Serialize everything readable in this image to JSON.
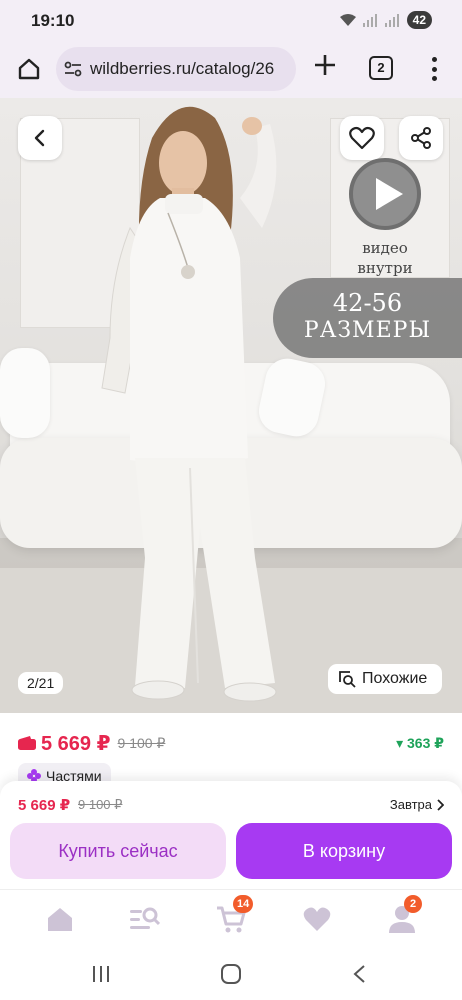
{
  "status_bar": {
    "time": "19:10",
    "battery": "42"
  },
  "browser": {
    "url": "wildberries.ru/catalog/26",
    "tab_count": "2"
  },
  "product": {
    "video_caption_line1": "видео",
    "video_caption_line2": "внутри",
    "sizes_line1": "42-56",
    "sizes_line2": "РАЗМЕРЫ",
    "image_counter": "2/21",
    "similar_label": "Похожие",
    "price": "5 669 ₽",
    "old_price": "9 100 ₽",
    "cashback": "▾ 363 ₽",
    "installments_label": "Частями"
  },
  "buy_panel": {
    "price": "5 669 ₽",
    "old_price": "9 100 ₽",
    "delivery": "Завтра",
    "buy_now_label": "Купить сейчас",
    "add_to_cart_label": "В корзину"
  },
  "tab_bar": {
    "cart_badge": "14",
    "profile_badge": "2"
  },
  "colors": {
    "price_red": "#e6264f",
    "brand_purple": "#a73af2",
    "light_purple": "#f3dcf7",
    "cashback_green": "#1fa35a",
    "badge_orange": "#f25c2b"
  }
}
